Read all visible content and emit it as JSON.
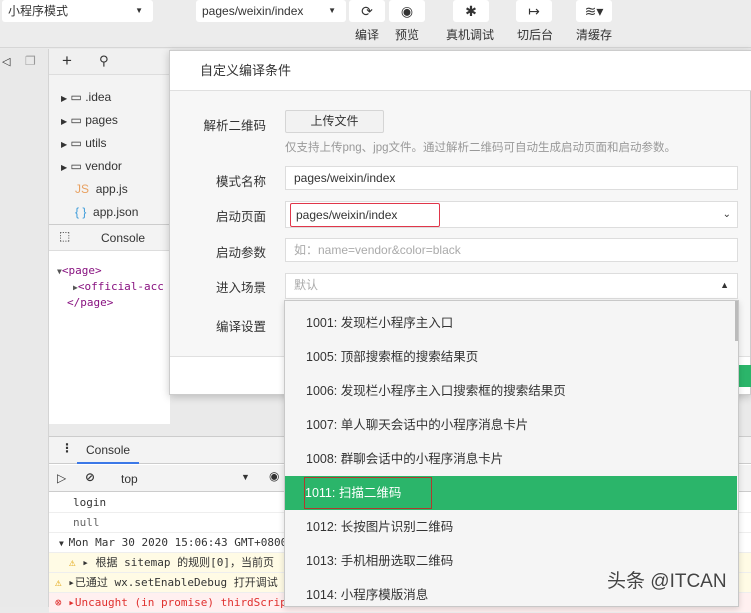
{
  "toolbar": {
    "mode": "小程序模式",
    "page": "pages/weixin/index",
    "buttons": [
      {
        "label": "编译",
        "icon": "refresh-icon"
      },
      {
        "label": "预览",
        "icon": "eye-icon"
      },
      {
        "label": "真机调试",
        "icon": "bug-icon"
      },
      {
        "label": "切后台",
        "icon": "switch-background-icon"
      },
      {
        "label": "清缓存",
        "icon": "layers-icon"
      }
    ]
  },
  "file_tree": {
    "items": [
      {
        "name": ".idea",
        "type": "folder"
      },
      {
        "name": "pages",
        "type": "folder"
      },
      {
        "name": "utils",
        "type": "folder"
      },
      {
        "name": "vendor",
        "type": "folder"
      },
      {
        "name": "app.js",
        "type": "js",
        "badge": "JS"
      },
      {
        "name": "app.json",
        "type": "json",
        "badge": "{ }"
      }
    ]
  },
  "devtools": {
    "tab": "Console",
    "dom": [
      "<page>",
      "<official-acc",
      "</page>"
    ]
  },
  "console": {
    "tab": "Console",
    "context": "top",
    "rows": [
      "login",
      "null",
      "Mon Mar 30 2020 15:06:43 GMT+0800",
      "根据 sitemap 的规则[0]，当前页",
      "已通过 wx.setEnableDebug 打开调试",
      "Uncaught (in promise) thirdScriptError"
    ]
  },
  "modal": {
    "title": "自定义编译条件",
    "qr_label": "解析二维码",
    "upload_label": "上传文件",
    "hint": "仅支持上传png、jpg文件。通过解析二维码可自动生成启动页面和启动参数。",
    "mode_name_label": "模式名称",
    "mode_name_value": "pages/weixin/index",
    "start_page_label": "启动页面",
    "start_page_value": "pages/weixin/index",
    "start_params_label": "启动参数",
    "start_params_placeholder": "如：name=vendor&color=black",
    "scene_label": "进入场景",
    "scene_placeholder": "默认",
    "compile_label": "编译设置"
  },
  "scene_options": [
    "1001: 发现栏小程序主入口",
    "1005: 顶部搜索框的搜索结果页",
    "1006: 发现栏小程序主入口搜索框的搜索结果页",
    "1007: 单人聊天会话中的小程序消息卡片",
    "1008: 群聊会话中的小程序消息卡片",
    "1011: 扫描二维码",
    "1012: 长按图片识别二维码",
    "1013: 手机相册选取二维码",
    "1014: 小程序模版消息"
  ],
  "selected_scene": "1011: 扫描二维码",
  "watermark": "头条 @ITCAN",
  "colors": {
    "accent": "#2bb56a",
    "highlight_border": "#e0364a"
  }
}
